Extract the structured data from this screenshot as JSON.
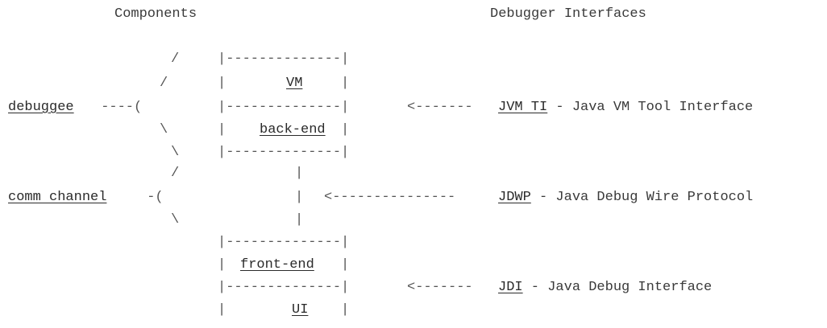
{
  "headers": {
    "left": "Components",
    "right": "Debugger Interfaces"
  },
  "components": {
    "debuggee": "debuggee",
    "comm_channel": "comm channel"
  },
  "stack": {
    "vm": "VM",
    "back_end": "back-end",
    "front_end": "front-end",
    "ui": "UI"
  },
  "interfaces": [
    {
      "abbr": "JVM TI",
      "description": " - Java VM Tool Interface"
    },
    {
      "abbr": "JDWP",
      "description": " - Java Debug Wire Protocol"
    },
    {
      "abbr": "JDI",
      "description": " - Java Debug Interface"
    }
  ],
  "ascii": {
    "box_top": "|--------------|",
    "box_side": "|              |",
    "slash": "/",
    "backslash": "\\",
    "pipe": "|",
    "debuggee_link": " ----(",
    "comm_link": " -(",
    "arrow_short": "<-------",
    "arrow_long": "<---------------"
  }
}
